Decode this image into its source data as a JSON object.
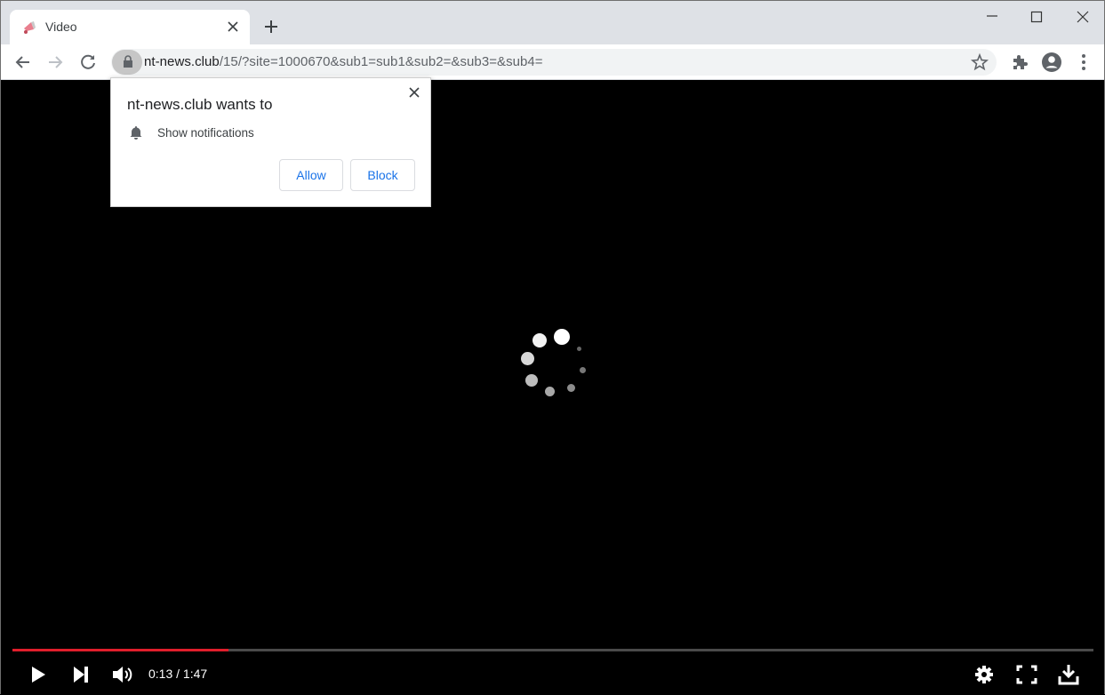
{
  "browser": {
    "tabs": [
      {
        "title": "Video",
        "favicon": "megaphone-icon",
        "active": true
      }
    ],
    "new_tab_icon": "plus-icon",
    "window_controls": [
      "minimize-icon",
      "maximize-icon",
      "close-icon"
    ],
    "nav": {
      "back_icon": "arrow-left-icon",
      "forward_icon": "arrow-right-icon",
      "reload_icon": "reload-icon"
    },
    "address_bar": {
      "lock_icon": "lock-icon",
      "host": "nt-news.club",
      "path": "/15/?site=1000670&sub1=sub1&sub2=&sub3=&sub4=",
      "bookmark_icon": "star-icon"
    },
    "toolbar_icons": [
      "extensions-icon",
      "profile-icon",
      "menu-icon"
    ]
  },
  "permission_popup": {
    "title": "nt-news.club wants to",
    "permission_icon": "bell-icon",
    "permission_label": "Show notifications",
    "allow_label": "Allow",
    "block_label": "Block",
    "close_icon": "close-icon"
  },
  "player": {
    "loading_icon": "spinner-icon",
    "progress_fraction": 0.2,
    "current_time": "0:13",
    "duration": "1:47",
    "time_display": "0:13 / 1:47",
    "controls": {
      "left": [
        "play-icon",
        "next-icon",
        "volume-icon"
      ],
      "right": [
        "settings-icon",
        "fullscreen-icon",
        "download-icon"
      ]
    },
    "colors": {
      "progress": "#e01e2b",
      "track": "#4a4a4a"
    }
  }
}
